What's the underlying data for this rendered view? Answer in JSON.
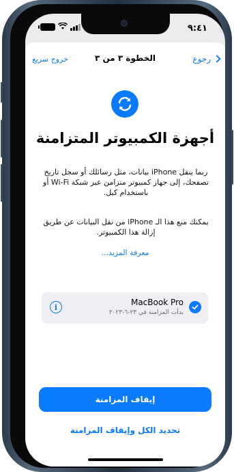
{
  "status_bar": {
    "time": "٩:٤١"
  },
  "nav": {
    "quit_label": "خروج سريع",
    "step_label": "الخطوة ٣ من ٣",
    "back_label": "رجوع"
  },
  "main": {
    "title": "أجهزة الكمبيوتر المتزامنة",
    "paragraph1": "ربما ينقل iPhone بيانات، مثل رسائلك أو سجل تاريخ تصفحك، إلى جهاز كمبيوتر متزامن عبر شبكة Wi-Fi أو باستخدام كبل.",
    "paragraph2": "يمكنك منع هذا الـ iPhone من نقل البيانات عن طريق إزالة هذا الكمبيوتر.",
    "learn_more": "معرفة المزيد..."
  },
  "device": {
    "name": "MacBook Pro",
    "subtitle": "بدأت المزامنة في ٢٣-٦-٢٠٢٣",
    "selected": true
  },
  "actions": {
    "stop_sync": "إيقاف المزامنة",
    "select_all_stop": "تحديد الكل وإيقاف المزامنة"
  },
  "colors": {
    "accent": "#0A7AFF",
    "card": "#EFEFF3",
    "screen_bg": "#ECECEE"
  },
  "icons": [
    "sync-icon",
    "info-icon",
    "checkmark-icon",
    "chevron-right-icon",
    "wifi-icon",
    "battery-icon",
    "signal-icon"
  ]
}
